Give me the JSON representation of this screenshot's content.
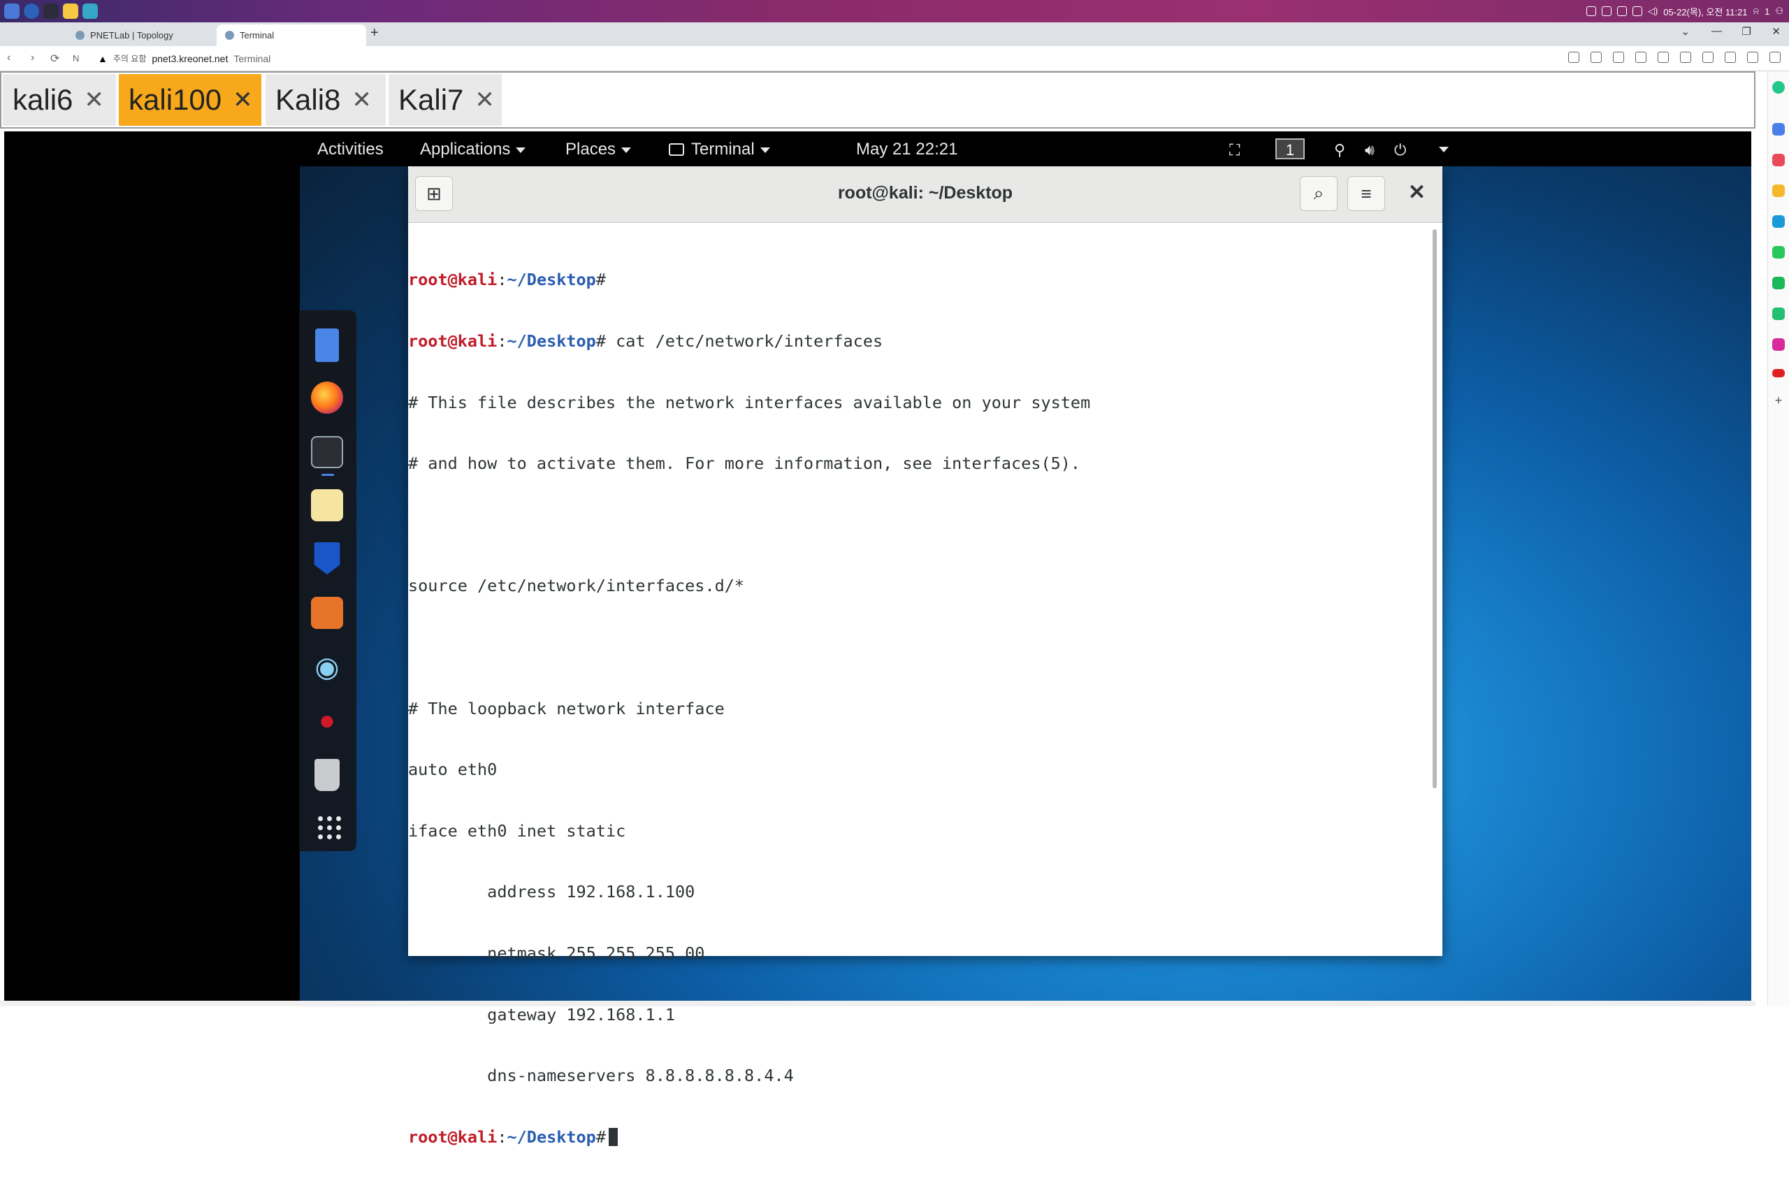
{
  "browser": {
    "tabs": [
      {
        "title": "PNETLab | Topology",
        "active": false
      },
      {
        "title": "Terminal",
        "active": true
      }
    ],
    "address": {
      "security_label": "주의 요함",
      "host": "pnet3.kreonet.net",
      "page_title": "Terminal"
    }
  },
  "os_tray": {
    "datetime": "05-22(목), 오전 11:21",
    "notification_count": "1"
  },
  "console_tabs": [
    {
      "label": "kali6",
      "active": false
    },
    {
      "label": "kali100",
      "active": true
    },
    {
      "label": "Kali8",
      "active": false
    },
    {
      "label": "Kali7",
      "active": false
    }
  ],
  "gnome_topbar": {
    "activities": "Activities",
    "applications": "Applications",
    "places": "Places",
    "terminal_menu": "Terminal",
    "clock": "May 21  22:21",
    "workspace": "1"
  },
  "dock": {
    "items": [
      {
        "name": "files",
        "icon": "files-icon"
      },
      {
        "name": "firefox",
        "icon": "firefox-icon"
      },
      {
        "name": "terminal",
        "icon": "terminal-icon",
        "running": true
      },
      {
        "name": "text-editor",
        "icon": "text-editor-icon"
      },
      {
        "name": "maltego",
        "icon": "maltego-icon"
      },
      {
        "name": "burp-suite",
        "icon": "burp-icon"
      },
      {
        "name": "eye",
        "icon": "eye-icon"
      },
      {
        "name": "cherrytree",
        "icon": "cherry-icon"
      },
      {
        "name": "trash",
        "icon": "trash-icon"
      },
      {
        "name": "show-apps",
        "icon": "app-grid-icon"
      }
    ]
  },
  "terminal": {
    "title": "root@kali: ~/Desktop",
    "prompt": {
      "user": "root@kali",
      "sep": ":",
      "path": "~/Desktop",
      "symbol": "#"
    },
    "command": " cat /etc/network/interfaces",
    "output": [
      "# This file describes the network interfaces available on your system",
      "# and how to activate them. For more information, see interfaces(5).",
      "",
      "source /etc/network/interfaces.d/*",
      "",
      "# The loopback network interface",
      "auto eth0",
      "iface eth0 inet static",
      "        address 192.168.1.100",
      "        netmask 255.255.255.00",
      "        gateway 192.168.1.1",
      "        dns-nameservers 8.8.8.8.8.8.4.4"
    ]
  },
  "colors": {
    "console_tab_active": "#f7a81b",
    "prompt_user": "#c01c28",
    "prompt_path": "#2a5db0"
  }
}
